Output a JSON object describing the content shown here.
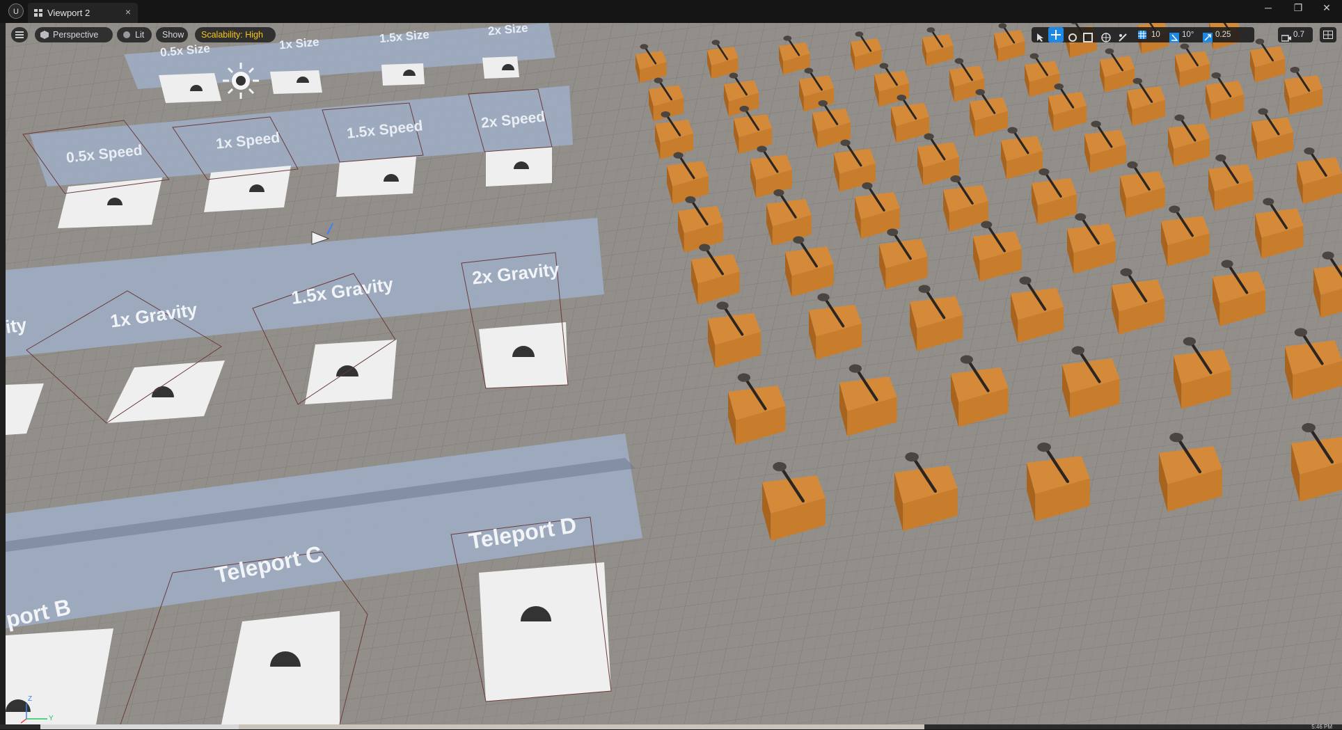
{
  "window": {
    "tab_title": "Viewport 2",
    "tab_close": "×",
    "controls": {
      "minimize": "─",
      "restore": "❐",
      "close": "✕"
    }
  },
  "toolbar_left": {
    "menu_icon": "hamburger-icon",
    "perspective": "Perspective",
    "lit": "Lit",
    "show": "Show",
    "scalability": "Scalability: High",
    "scalability_color": "#f5c518"
  },
  "toolbar_right": {
    "tools": [
      "select-icon",
      "translate-icon",
      "rotate-icon",
      "scale-icon",
      "world-local-icon",
      "surface-snap-icon"
    ],
    "grid_snap": "10",
    "rotation_snap": "10°",
    "scale_snap": "0.25",
    "camera_speed": "0.7",
    "accent": "#1e88e5"
  },
  "scene": {
    "size_labels": [
      "0.5x Size",
      "1x Size",
      "1.5x Size",
      "2x Size"
    ],
    "speed_labels": [
      "0.5x Speed",
      "1x Speed",
      "1.5x Speed",
      "2x Speed"
    ],
    "gravity_labels": [
      "ity",
      "1x Gravity",
      "1.5x Gravity",
      "2x Gravity"
    ],
    "teleport_labels": [
      "port B",
      "Teleport C",
      "Teleport D"
    ],
    "floor_color": "#8f8c88",
    "pedestal_color": "#c77d2c"
  },
  "axis_gizmo": {
    "z": "Z",
    "y": "Y"
  },
  "status": {
    "clock": "5:46 PM"
  }
}
